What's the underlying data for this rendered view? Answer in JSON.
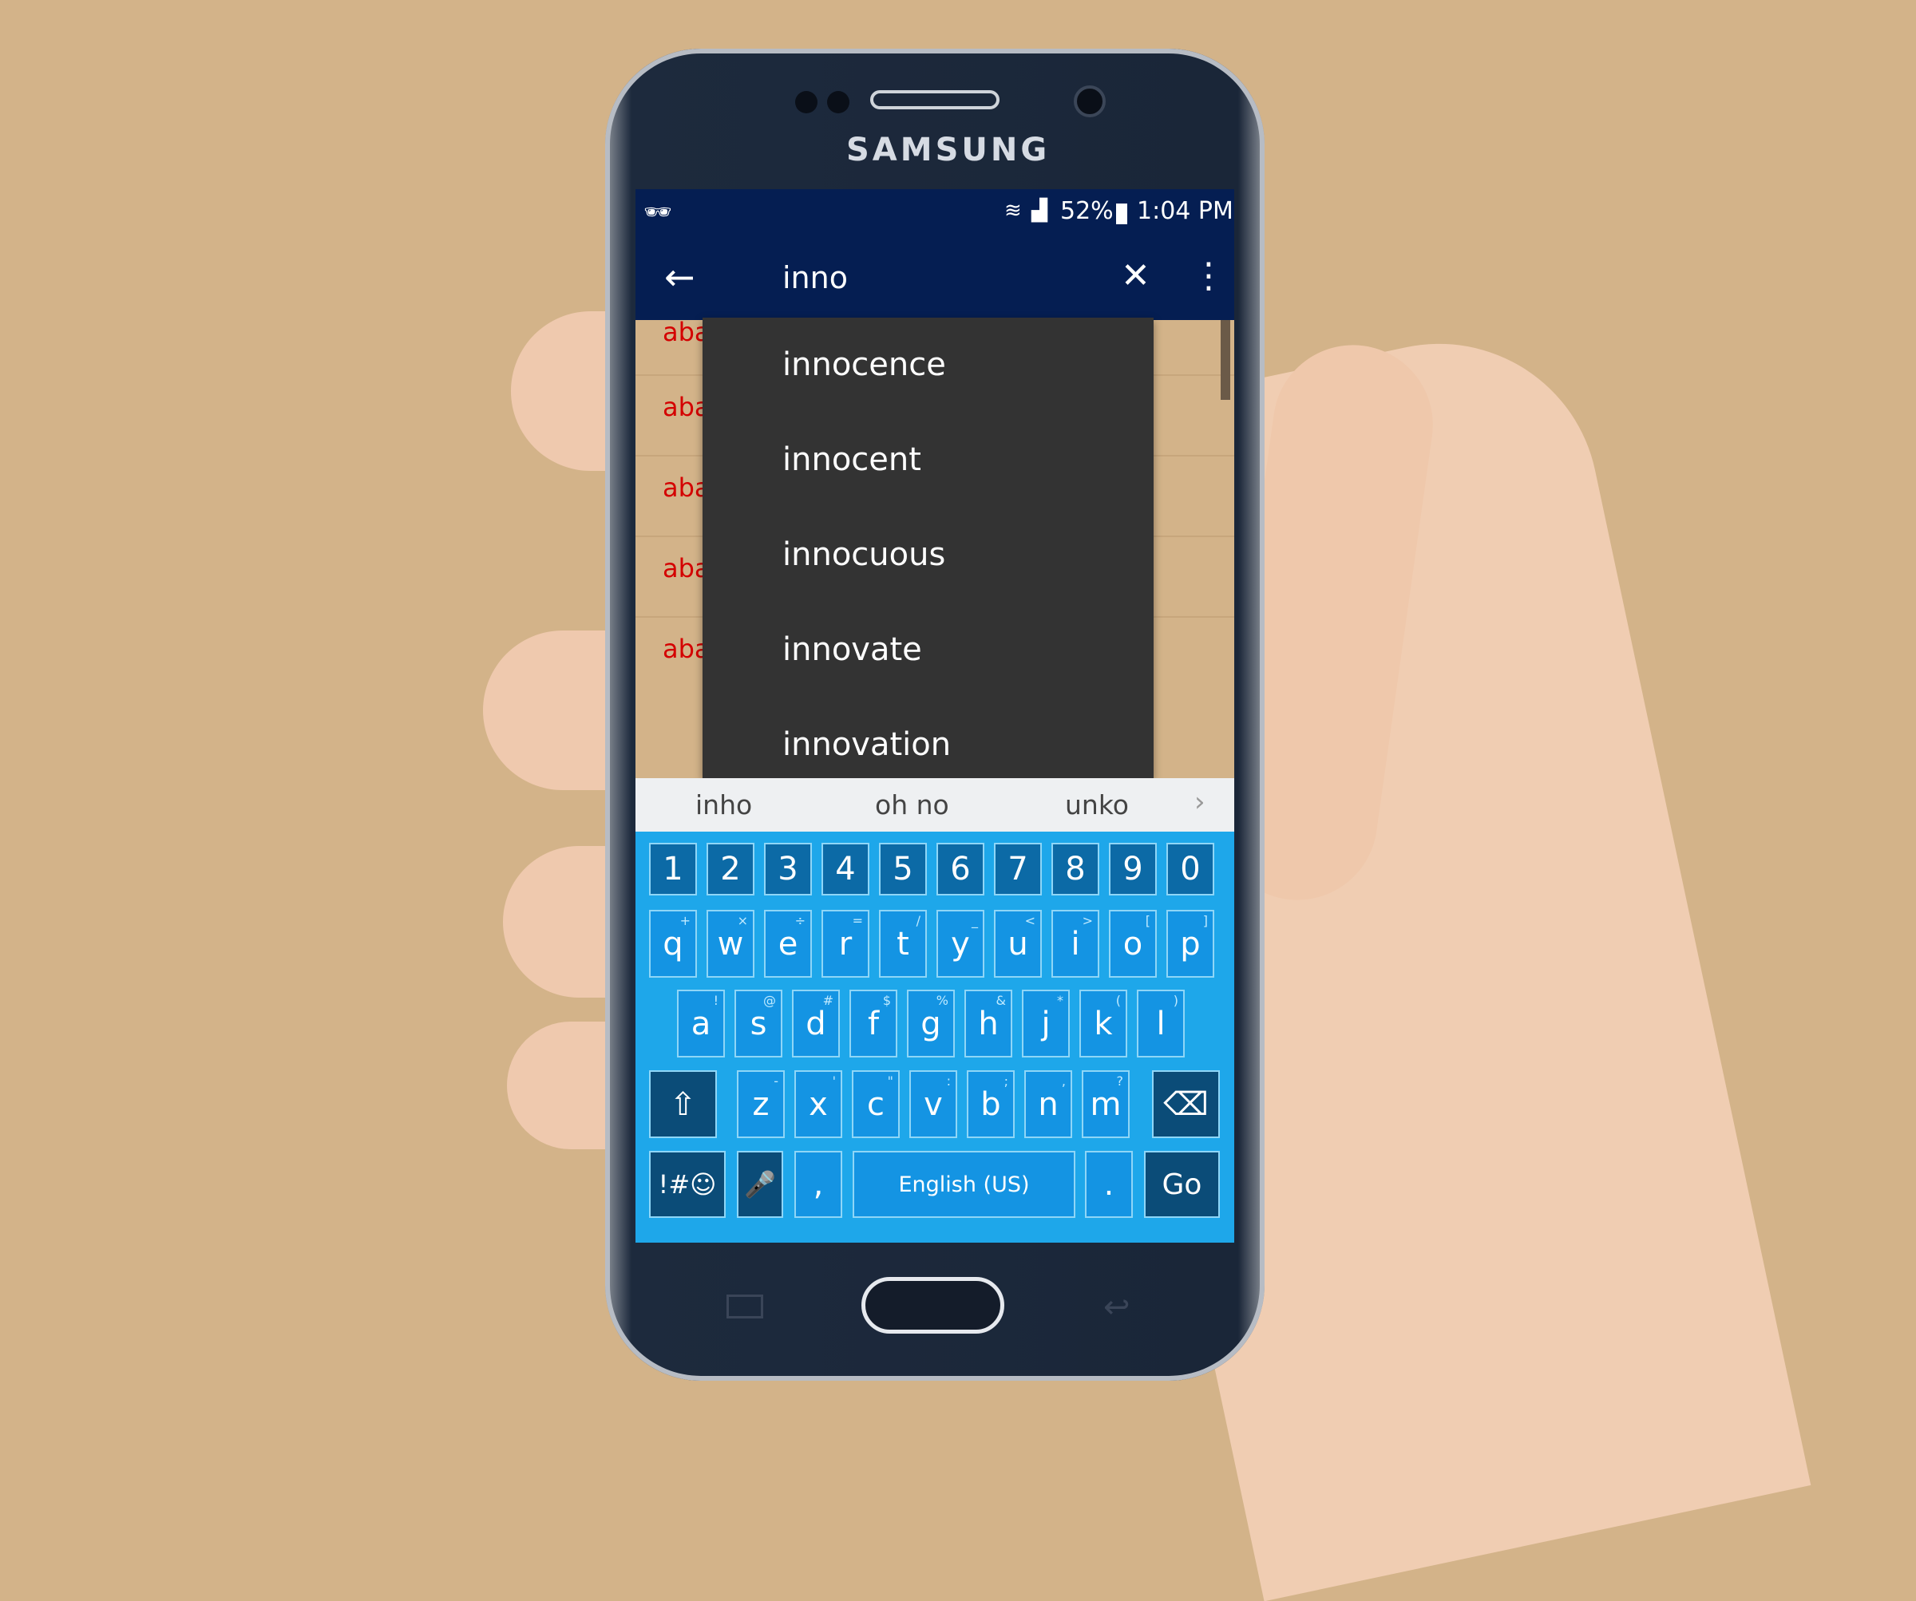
{
  "device": {
    "brand": "SAMSUNG"
  },
  "status_bar": {
    "incognito_icon": "incognito-icon",
    "battery": "52%",
    "time": "1:04 PM"
  },
  "app_bar": {
    "query": "inno",
    "back_icon": "arrow-left-icon",
    "clear_icon": "close-icon",
    "menu_icon": "more-vert-icon"
  },
  "list": {
    "items": [
      "aba",
      "aba",
      "aba",
      "aba",
      "aba"
    ]
  },
  "dropdown": {
    "items": [
      "innocence",
      "innocent",
      "innocuous",
      "innovate",
      "innovation"
    ]
  },
  "suggestions": {
    "words": [
      "inho",
      "oh no",
      "unko"
    ],
    "more_icon": "chevron-right-icon"
  },
  "keyboard": {
    "numbers": [
      "1",
      "2",
      "3",
      "4",
      "5",
      "6",
      "7",
      "8",
      "9",
      "0"
    ],
    "row1": [
      [
        "q",
        "+"
      ],
      [
        "w",
        "×"
      ],
      [
        "e",
        "÷"
      ],
      [
        "r",
        "="
      ],
      [
        "t",
        "/"
      ],
      [
        "y",
        "_"
      ],
      [
        "u",
        "<"
      ],
      [
        "i",
        ">"
      ],
      [
        "o",
        "["
      ],
      [
        "p",
        "]"
      ]
    ],
    "row2": [
      [
        "a",
        "!"
      ],
      [
        "s",
        "@"
      ],
      [
        "d",
        "#"
      ],
      [
        "f",
        "$"
      ],
      [
        "g",
        "%"
      ],
      [
        "h",
        "&"
      ],
      [
        "j",
        "*"
      ],
      [
        "k",
        "("
      ],
      [
        "l",
        ")"
      ]
    ],
    "row3": [
      [
        "z",
        "-"
      ],
      [
        "x",
        "'"
      ],
      [
        "c",
        "\""
      ],
      [
        "v",
        ":"
      ],
      [
        "b",
        ";"
      ],
      [
        "n",
        ","
      ],
      [
        "m",
        "?"
      ]
    ],
    "symbols": "!#☺",
    "comma": ",",
    "space": "English (US)",
    "period": ".",
    "go": "Go"
  },
  "colors": {
    "app_bar": "#051e52",
    "keyboard": "#1ea7ea",
    "list_text": "#d40000",
    "dropdown": "#333333"
  }
}
